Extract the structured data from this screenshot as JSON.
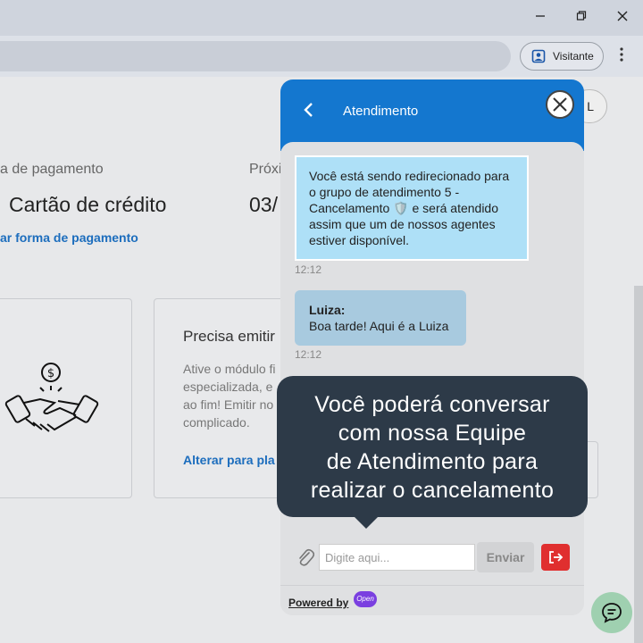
{
  "browser": {
    "visitor_label": "Visitante"
  },
  "page": {
    "payment_label": "a de pagamento",
    "payment_value": "Cartão de crédito",
    "payment_link": "ar forma de pagamento",
    "next_label": "Próxi",
    "next_value": "03/",
    "user_initial": "L",
    "card2": {
      "title": "Precisa emitir",
      "text_lines": [
        "Ative o módulo fi",
        "especializada, e",
        "ao fim! Emitir no",
        "complicado."
      ],
      "link": "Alterar para pla"
    }
  },
  "chat": {
    "title": "Atendimento",
    "messages": [
      {
        "type": "system",
        "text": "Você está sendo redirecionado para o grupo de atendimento 5 - Cancelamento 🛡️ e será atendido assim que um de nossos agentes estiver disponível.",
        "time": "12:12"
      },
      {
        "type": "agent",
        "author": "Luiza:",
        "text": "Boa tarde! Aqui é a Luiza",
        "time": "12:12"
      }
    ],
    "input_placeholder": "Digite aqui...",
    "send_label": "Enviar",
    "powered_by": "Powered by",
    "powered_logo": "Open"
  },
  "callout": {
    "lines": [
      "Você poderá conversar",
      "com nossa Equipe",
      "de Atendimento para",
      "realizar o cancelamento"
    ]
  },
  "colors": {
    "chat_header": "#1477cf",
    "system_bubble": "#aee0f7",
    "agent_bubble": "#a8cadf",
    "callout_bg": "#2d3a48",
    "leave_button": "#e02f2f",
    "link": "#1c6dbd"
  },
  "icons": [
    "minimize-icon",
    "restore-icon",
    "close-window-icon",
    "profile-icon",
    "menu-dots-icon",
    "handshake-dollar-icon",
    "back-arrow-icon",
    "close-icon",
    "paperclip-icon",
    "leave-chat-icon",
    "chat-bubble-icon"
  ]
}
